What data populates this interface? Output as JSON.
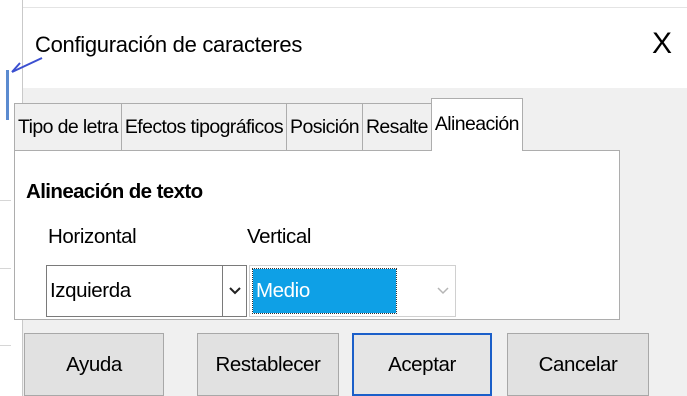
{
  "dialog": {
    "title": "Configuración de caracteres",
    "close_icon": "close-icon",
    "close_glyph": "X"
  },
  "tabs": [
    {
      "label": "Tipo de letra",
      "active": false
    },
    {
      "label": "Efectos tipográficos",
      "active": false
    },
    {
      "label": "Posición",
      "active": false
    },
    {
      "label": "Resalte",
      "active": false
    },
    {
      "label": "Alineación",
      "active": true
    }
  ],
  "alignment": {
    "section_title": "Alineación de texto",
    "horizontal": {
      "label": "Horizontal",
      "value": "Izquierda"
    },
    "vertical": {
      "label": "Vertical",
      "value": "Medio"
    }
  },
  "buttons": {
    "help": "Ayuda",
    "reset": "Restablecer",
    "ok": "Aceptar",
    "cancel": "Cancelar"
  },
  "colors": {
    "selection": "#0ea0e6",
    "default_button_border": "#1b5fc9"
  }
}
